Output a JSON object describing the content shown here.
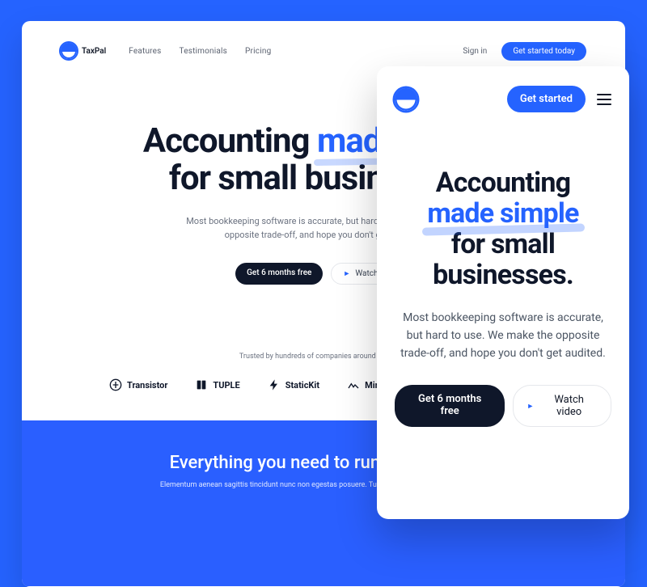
{
  "brand": {
    "name": "TaxPal"
  },
  "desktop": {
    "nav": {
      "features": "Features",
      "testimonials": "Testimonials",
      "pricing": "Pricing"
    },
    "signin": "Sign in",
    "cta": "Get started today",
    "hero": {
      "line1a": "Accounting ",
      "highlight": "made simple",
      "line2": "for small businesses.",
      "subtitle": "Most bookkeeping software is accurate, but hard to use. We make the opposite trade-off, and hope you don't get audited.",
      "primary_btn": "Get 6 months free",
      "secondary_btn": "Watch video"
    },
    "trusted_text": "Trusted by hundreds of companies around the globe",
    "company_logos": {
      "transistor": "Transistor",
      "tuple": "TUPLE",
      "statickit": "StaticKit",
      "mirage": "Mirage"
    },
    "blue": {
      "heading": "Everything you need to run your books.",
      "sub": "Elementum aenean sagittis tincidunt nunc non egestas posuere. Turpis lorem congue aenean tempor."
    }
  },
  "mobile": {
    "cta": "Get started",
    "hero": {
      "line1": "Accounting",
      "highlight": "made simple",
      "line3": "for small",
      "line4": "businesses.",
      "subtitle": "Most bookkeeping software is accurate, but hard to use. We make the opposite trade-off, and hope you don't get audited.",
      "primary_btn": "Get 6 months free",
      "secondary_btn": "Watch video"
    }
  }
}
